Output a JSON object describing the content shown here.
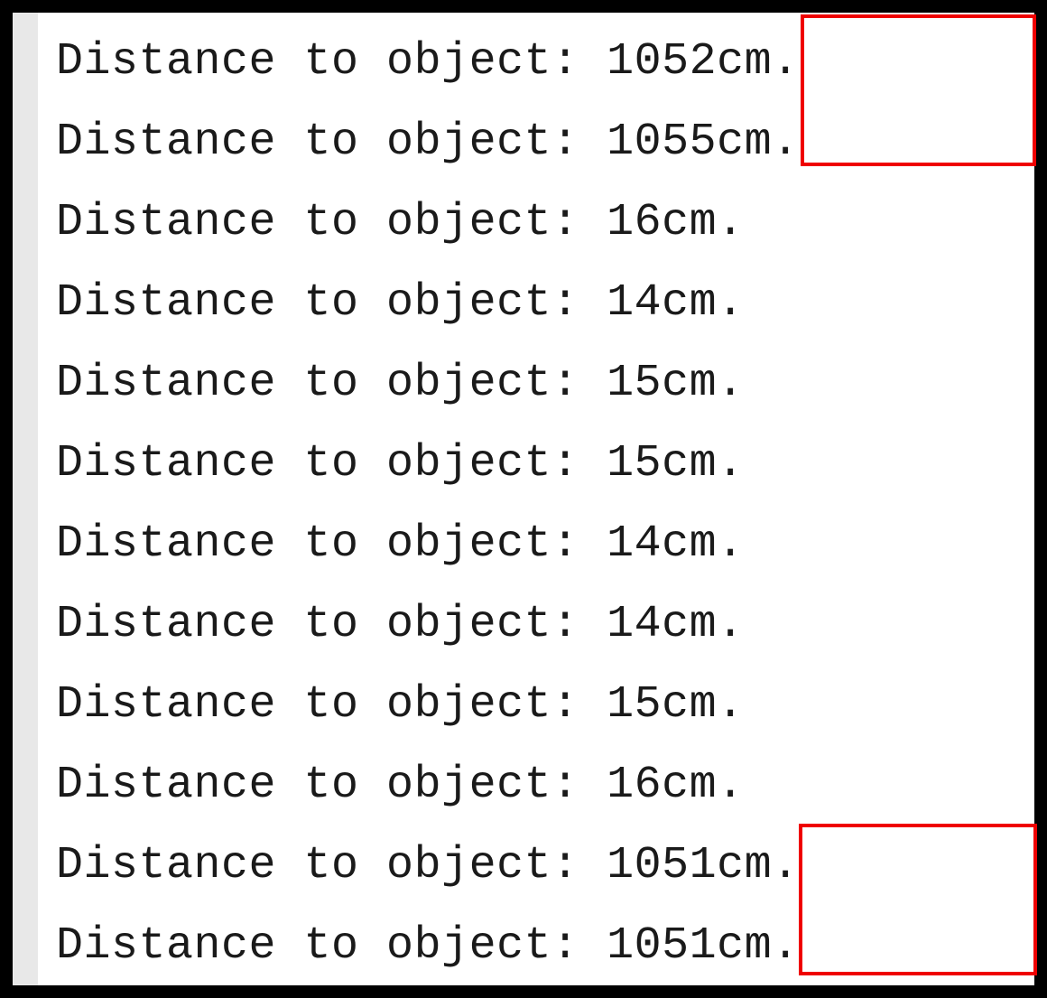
{
  "label": "Distance to object:",
  "unit": "cm",
  "readings": [
    {
      "value": 1052,
      "highlighted": true
    },
    {
      "value": 1055,
      "highlighted": true
    },
    {
      "value": 16,
      "highlighted": false
    },
    {
      "value": 14,
      "highlighted": false
    },
    {
      "value": 15,
      "highlighted": false
    },
    {
      "value": 15,
      "highlighted": false
    },
    {
      "value": 14,
      "highlighted": false
    },
    {
      "value": 14,
      "highlighted": false
    },
    {
      "value": 15,
      "highlighted": false
    },
    {
      "value": 16,
      "highlighted": false
    },
    {
      "value": 1051,
      "highlighted": true
    },
    {
      "value": 1051,
      "highlighted": true
    }
  ],
  "highlight_color": "#ef0000"
}
